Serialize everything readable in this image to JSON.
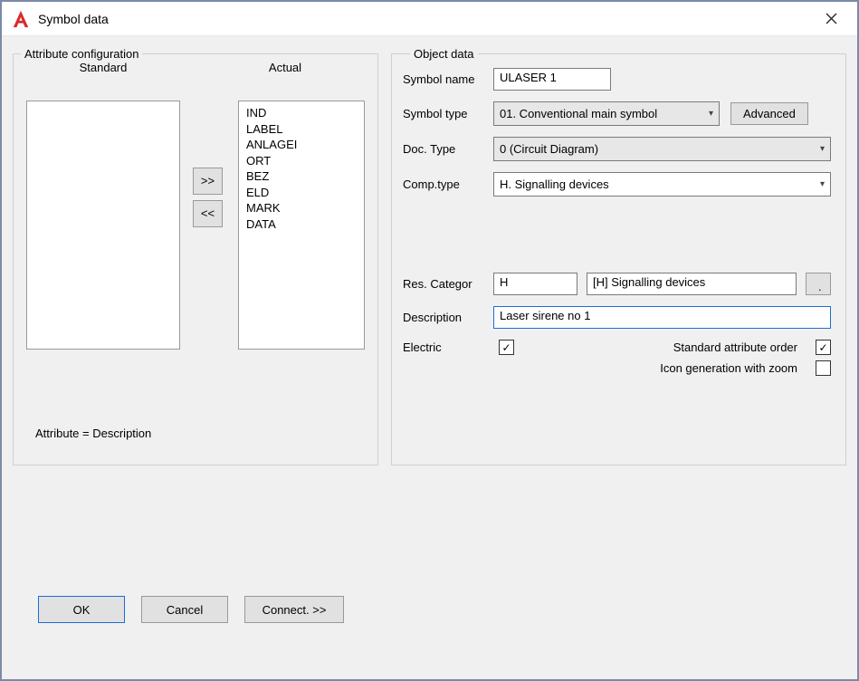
{
  "title": "Symbol data",
  "attr": {
    "legend": "Attribute configuration",
    "std_header": "Standard",
    "actual_header": "Actual",
    "items": [
      "IND",
      "LABEL",
      "ANLAGEI",
      "ORT",
      "BEZ",
      "ELD",
      "MARK",
      "DATA"
    ],
    "move_right": ">>",
    "move_left": "<<",
    "footer": "Attribute = Description"
  },
  "obj": {
    "legend": "Object data",
    "symbol_name_label": "Symbol name",
    "symbol_name": "ULASER 1",
    "symbol_type_label": "Symbol type",
    "symbol_type": "01. Conventional main symbol",
    "advanced": "Advanced",
    "doc_type_label": "Doc. Type",
    "doc_type": "0 (Circuit Diagram)",
    "comp_type_label": "Comp.type",
    "comp_type": "H. Signalling devices",
    "res_categor_label": "Res. Categor",
    "res_categor_code": "H",
    "res_categor_desc": "[H] Signalling devices",
    "dots": ". .",
    "description_label": "Description",
    "description": "Laser sirene no 1",
    "electric_label": "Electric",
    "std_attr_order_label": "Standard attribute order",
    "icon_gen_label": "Icon generation with zoom"
  },
  "buttons": {
    "ok": "OK",
    "cancel": "Cancel",
    "connect": "Connect. >>"
  }
}
